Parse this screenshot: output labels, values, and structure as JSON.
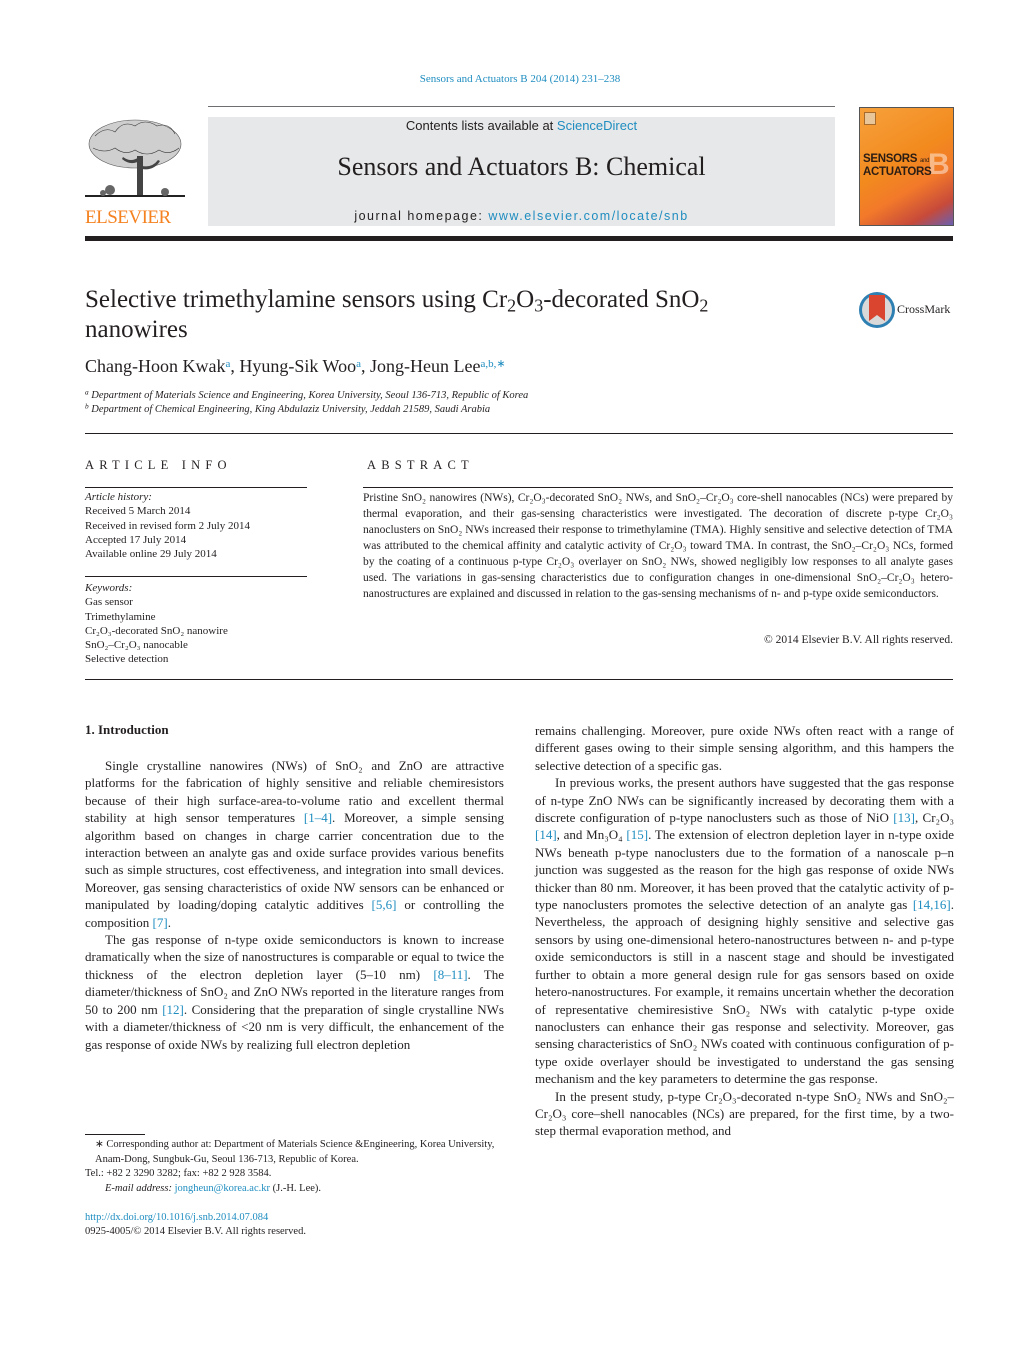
{
  "header": {
    "journal_ref": "Sensors and Actuators B 204 (2014) 231–238",
    "contents_prefix": "Contents lists available at ",
    "contents_link": "ScienceDirect",
    "journal_title": "Sensors and Actuators B: Chemical",
    "homepage_prefix": "journal homepage: ",
    "homepage_link": "www.elsevier.com/locate/snb",
    "publisher_logo_text": "ELSEVIER",
    "cover_line1": "SENSORS",
    "cover_line1_small": "and",
    "cover_line2": "ACTUATORS",
    "cover_letter": "B",
    "crossmark_label": "CrossMark",
    "colors": {
      "link": "#1f8dc0",
      "elsevier_orange": "#f58220",
      "header_box": "#e7e8e9"
    }
  },
  "article": {
    "title_parts": [
      "Selective trimethylamine sensors using Cr",
      "2",
      "O",
      "3",
      "-decorated SnO",
      "2",
      " nanowires"
    ],
    "authors": [
      {
        "name": "Chang-Hoon Kwak",
        "affil": "a"
      },
      {
        "name": "Hyung-Sik Woo",
        "affil": "a"
      },
      {
        "name": "Jong-Heun Lee",
        "affil": "a,b,∗"
      }
    ],
    "affiliations": [
      {
        "mark": "a",
        "text": "Department of Materials Science and Engineering, Korea University, Seoul 136-713, Republic of Korea"
      },
      {
        "mark": "b",
        "text": "Department of Chemical Engineering, King Abdulaziz University, Jeddah 21589, Saudi Arabia"
      }
    ]
  },
  "article_info": {
    "heading": "ARTICLE INFO",
    "history_label": "Article history:",
    "history": [
      "Received 5 March 2014",
      "Received in revised form 2 July 2014",
      "Accepted 17 July 2014",
      "Available online 29 July 2014"
    ],
    "keywords_label": "Keywords:",
    "keywords": [
      "Gas sensor",
      "Trimethylamine",
      "Cr₂O₃-decorated SnO₂ nanowire",
      "SnO₂–Cr₂O₃ nanocable",
      "Selective detection"
    ]
  },
  "abstract": {
    "heading": "ABSTRACT",
    "text": "Pristine SnO₂ nanowires (NWs), Cr₂O₃-decorated SnO₂ NWs, and SnO₂–Cr₂O₃ core-shell nanocables (NCs) were prepared by thermal evaporation, and their gas-sensing characteristics were investigated. The decoration of discrete p-type Cr₂O₃ nanoclusters on SnO₂ NWs increased their response to trimethylamine (TMA). Highly sensitive and selective detection of TMA was attributed to the chemical affinity and catalytic activity of Cr₂O₃ toward TMA. In contrast, the SnO₂–Cr₂O₃ NCs, formed by the coating of a continuous p-type Cr₂O₃ overlayer on SnO₂ NWs, showed negligibly low responses to all analyte gases used. The variations in gas-sensing characteristics due to configuration changes in one-dimensional SnO₂–Cr₂O₃ hetero-nanostructures are explained and discussed in relation to the gas-sensing mechanisms of n- and p-type oxide semiconductors.",
    "copyright": "© 2014 Elsevier B.V. All rights reserved."
  },
  "body": {
    "section_heading": "1.  Introduction",
    "left_paragraphs": [
      {
        "segments": [
          {
            "t": "Single crystalline nanowires (NWs) of SnO₂ and ZnO are attractive platforms for the fabrication of highly sensitive and reliable chemiresistors because of their high surface-area-to-volume ratio and excellent thermal stability at high sensor temperatures "
          },
          {
            "ref": "[1–4]"
          },
          {
            "t": ". Moreover, a simple sensing algorithm based on changes in charge carrier concentration due to the interaction between an analyte gas and oxide surface provides various benefits such as simple structures, cost effectiveness, and integration into small devices. Moreover, gas sensing characteristics of oxide NW sensors can be enhanced or manipulated by loading/doping catalytic additives "
          },
          {
            "ref": "[5,6]"
          },
          {
            "t": " or controlling the composition "
          },
          {
            "ref": "[7]"
          },
          {
            "t": "."
          }
        ]
      },
      {
        "segments": [
          {
            "t": "The gas response of n-type oxide semiconductors is known to increase dramatically when the size of nanostructures is comparable or equal to twice the thickness of the electron depletion layer (5–10 nm) "
          },
          {
            "ref": "[8–11]"
          },
          {
            "t": ". The diameter/thickness of SnO₂ and ZnO NWs reported in the literature ranges from 50 to 200 nm "
          },
          {
            "ref": "[12]"
          },
          {
            "t": ". Considering that the preparation of single crystalline NWs with a diameter/thickness of <20 nm is very difficult, the enhancement of the gas response of oxide NWs by realizing full electron depletion"
          }
        ]
      }
    ],
    "right_paragraphs": [
      {
        "noindent": true,
        "segments": [
          {
            "t": "remains challenging. Moreover, pure oxide NWs often react with a range of different gases owing to their simple sensing algorithm, and this hampers the selective detection of a specific gas."
          }
        ]
      },
      {
        "segments": [
          {
            "t": "In previous works, the present authors have suggested that the gas response of n-type ZnO NWs can be significantly increased by decorating them with a discrete configuration of p-type nanoclusters such as those of NiO "
          },
          {
            "ref": "[13]"
          },
          {
            "t": ", Cr₂O₃ "
          },
          {
            "ref": "[14]"
          },
          {
            "t": ", and Mn₃O₄ "
          },
          {
            "ref": "[15]"
          },
          {
            "t": ". The extension of electron depletion layer in n-type oxide NWs beneath p-type nanoclusters due to the formation of a nanoscale p–n junction was suggested as the reason for the high gas response of oxide NWs thicker than 80 nm. Moreover, it has been proved that the catalytic activity of p-type nanoclusters promotes the selective detection of an analyte gas "
          },
          {
            "ref": "[14,16]"
          },
          {
            "t": ". Nevertheless, the approach of designing highly sensitive and selective gas sensors by using one-dimensional hetero-nanostructures between n- and p-type oxide semiconductors is still in a nascent stage and should be investigated further to obtain a more general design rule for gas sensors based on oxide hetero-nanostructures. For example, it remains uncertain whether the decoration of representative chemiresistive SnO₂ NWs with catalytic p-type oxide nanoclusters can enhance their gas response and selectivity. Moreover, gas sensing characteristics of SnO₂ NWs coated with continuous configuration of p-type oxide overlayer should be investigated to understand the gas sensing mechanism and the key parameters to determine the gas response."
          }
        ]
      },
      {
        "segments": [
          {
            "t": "In the present study, p-type Cr₂O₃-decorated n-type SnO₂ NWs and SnO₂–Cr₂O₃ core–shell nanocables (NCs) are prepared, for the first time, by a two-step thermal evaporation method, and"
          }
        ]
      }
    ]
  },
  "footnote": {
    "corresponding": "∗ Corresponding author at: Department of Materials Science &Engineering, Korea University, Anam-Dong, Sungbuk-Gu, Seoul 136-713, Republic of Korea.",
    "tel": "Tel.: +82 2 3290 3282; fax: +82 2 928 3584.",
    "email_label": "E-mail address: ",
    "email": "jongheun@korea.ac.kr",
    "email_suffix": " (J.-H. Lee).",
    "doi": "http://dx.doi.org/10.1016/j.snb.2014.07.084",
    "issn": "0925-4005/© 2014 Elsevier B.V. All rights reserved."
  }
}
